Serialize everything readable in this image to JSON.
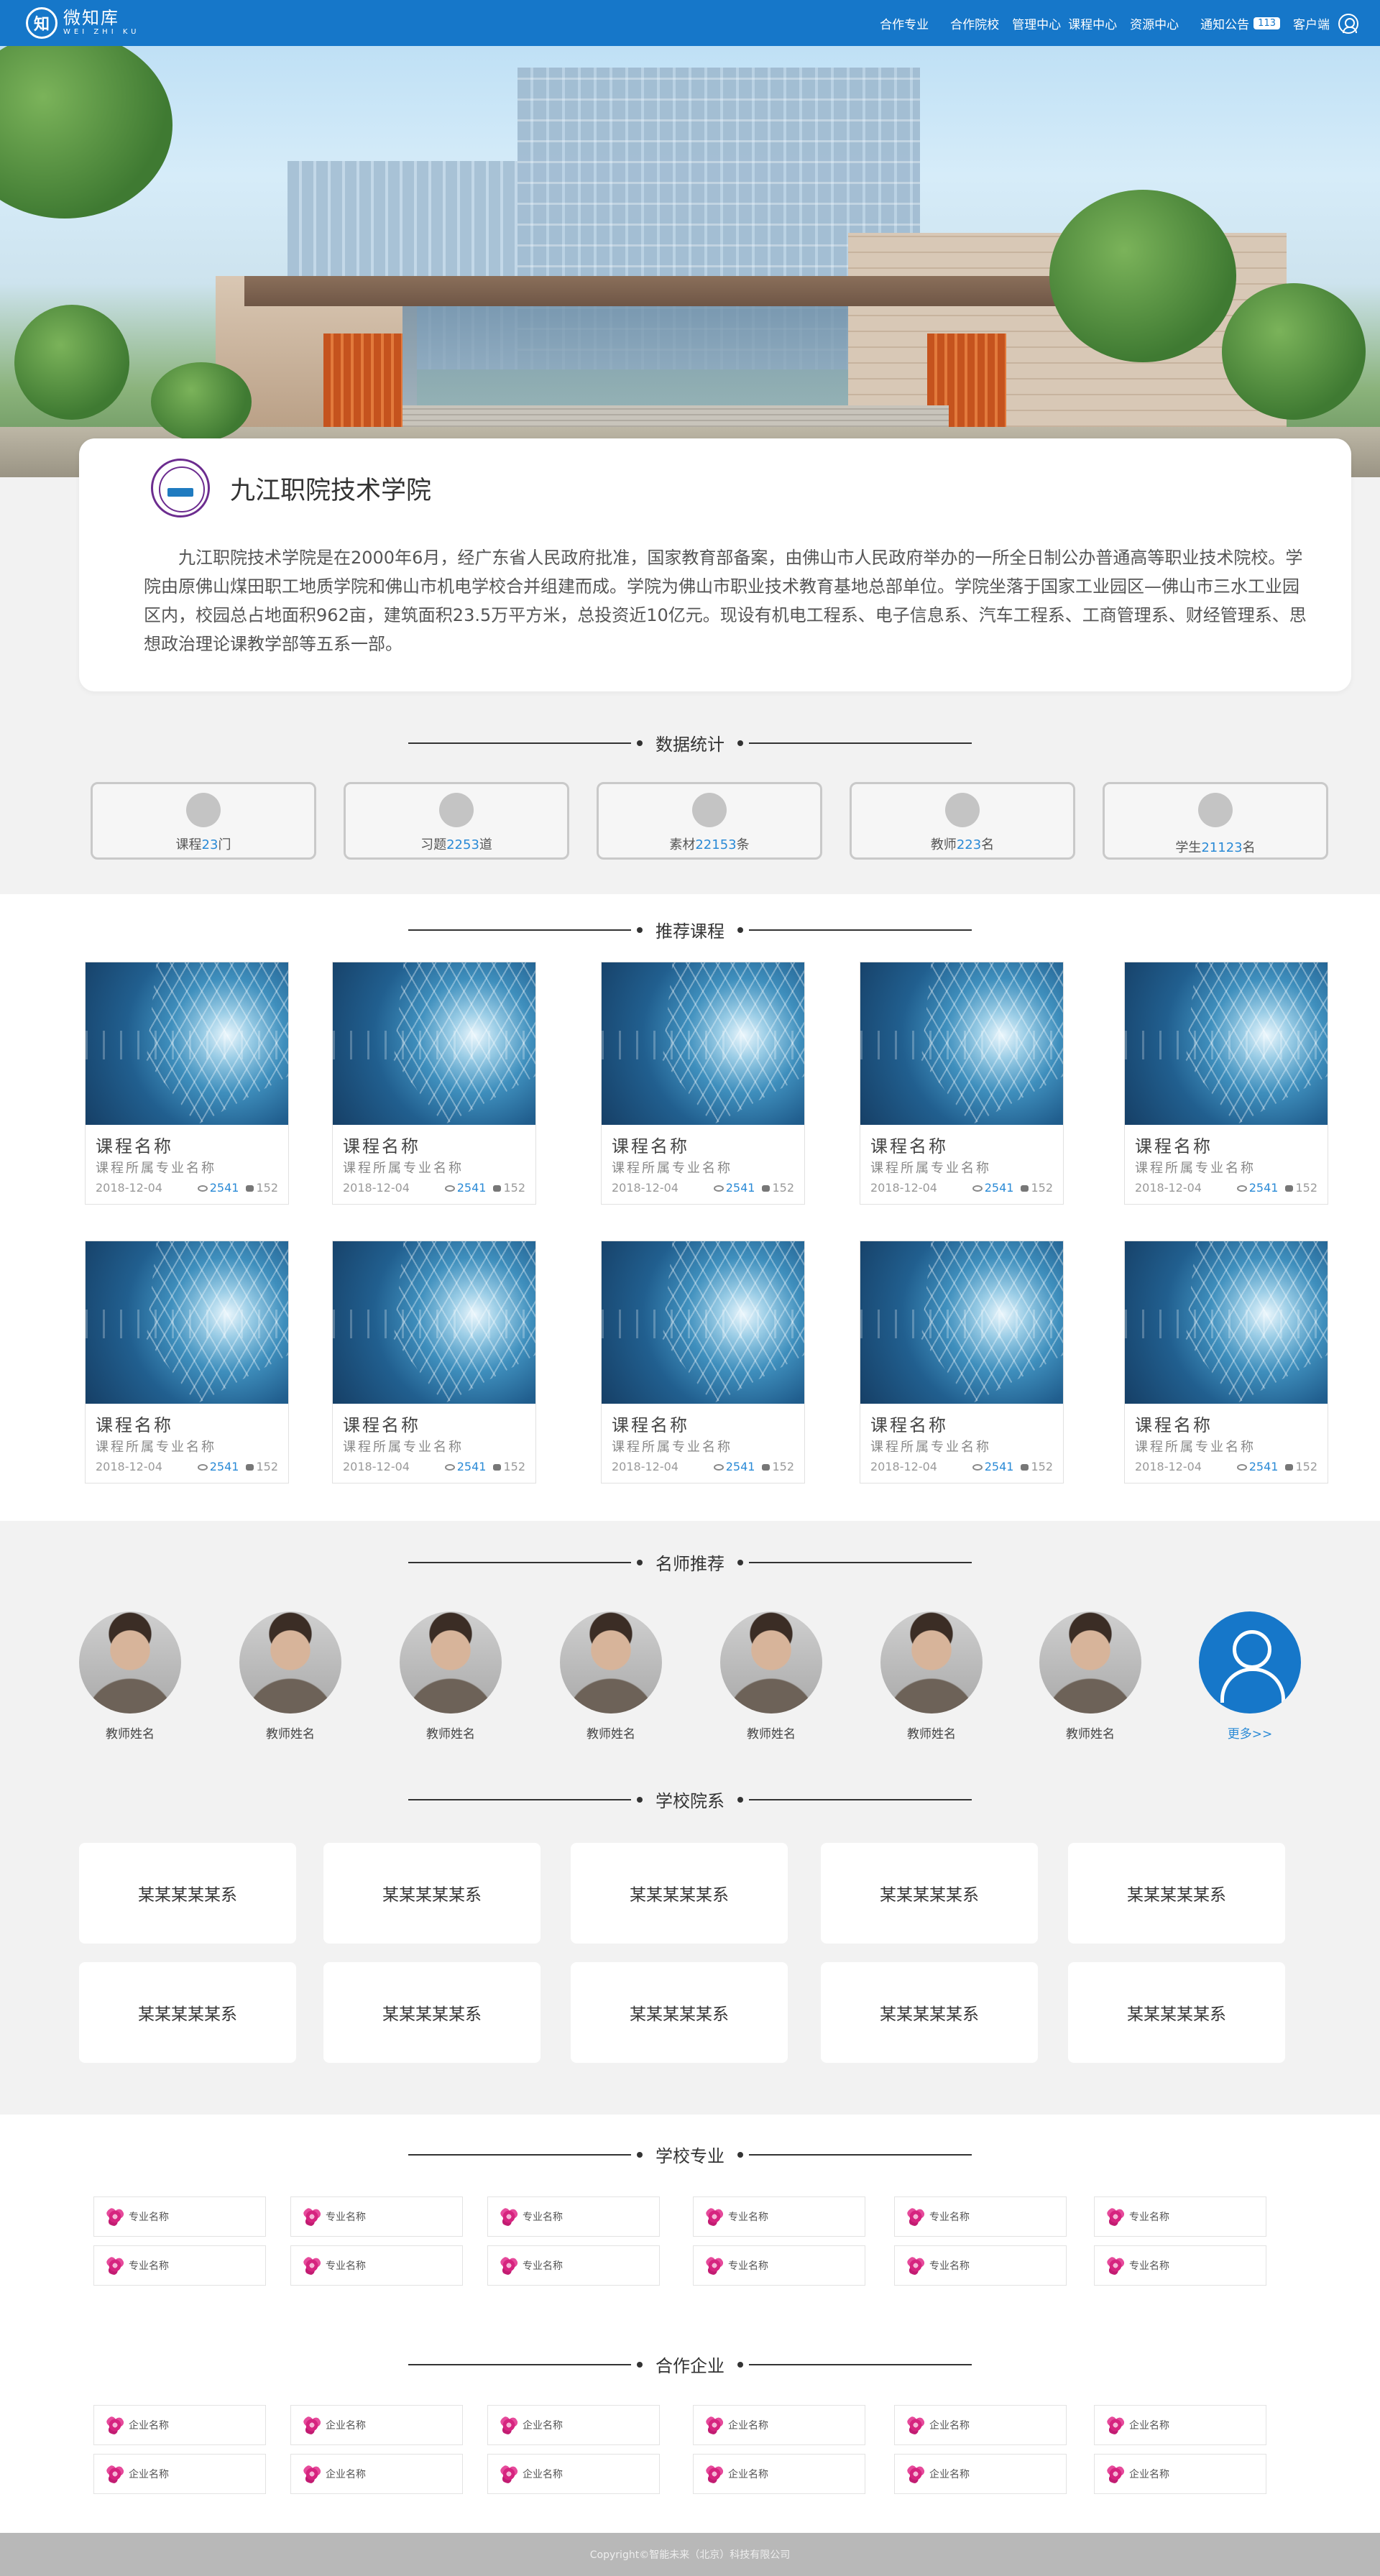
{
  "brand": {
    "logo_glyph": "知",
    "name_cn": "微知库",
    "name_en": "WEI ZHI KU"
  },
  "nav": {
    "items": [
      "合作专业",
      "合作院校",
      "管理中心",
      "课程中心",
      "资源中心"
    ],
    "notice_label": "通知公告",
    "notice_count": "113",
    "client_label": "客户端"
  },
  "school": {
    "name": "九江职院技术学院",
    "description": "九江职院技术学院是在2000年6月，经广东省人民政府批准，国家教育部备案，由佛山市人民政府举办的一所全日制公办普通高等职业技术院校。学院由原佛山煤田职工地质学院和佛山市机电学校合并组建而成。学院为佛山市职业技术教育基地总部单位。学院坐落于国家工业园区—佛山市三水工业园区内，校园总占地面积962亩，建筑面积23.5万平方米，总投资近10亿元。现设有机电工程系、电子信息系、汽车工程系、工商管理系、财经管理系、思想政治理论课教学部等五系一部。"
  },
  "sections": {
    "stats": "数据统计",
    "courses": "推荐课程",
    "teachers": "名师推荐",
    "departments": "学校院系",
    "majors": "学校专业",
    "companies": "合作企业"
  },
  "stats": [
    {
      "label": "课程",
      "value": "23",
      "unit": "门"
    },
    {
      "label": "习题",
      "value": "2253",
      "unit": "道"
    },
    {
      "label": "素材",
      "value": "22153",
      "unit": "条"
    },
    {
      "label": "教师",
      "value": "223",
      "unit": "名"
    },
    {
      "label": "学生",
      "value": "21123",
      "unit": "名"
    }
  ],
  "courses": [
    {
      "name": "课程名称",
      "major": "课程所属专业名称",
      "date": "2018-12-04",
      "views": "2541",
      "comments": "152"
    },
    {
      "name": "课程名称",
      "major": "课程所属专业名称",
      "date": "2018-12-04",
      "views": "2541",
      "comments": "152"
    },
    {
      "name": "课程名称",
      "major": "课程所属专业名称",
      "date": "2018-12-04",
      "views": "2541",
      "comments": "152"
    },
    {
      "name": "课程名称",
      "major": "课程所属专业名称",
      "date": "2018-12-04",
      "views": "2541",
      "comments": "152"
    },
    {
      "name": "课程名称",
      "major": "课程所属专业名称",
      "date": "2018-12-04",
      "views": "2541",
      "comments": "152"
    },
    {
      "name": "课程名称",
      "major": "课程所属专业名称",
      "date": "2018-12-04",
      "views": "2541",
      "comments": "152"
    },
    {
      "name": "课程名称",
      "major": "课程所属专业名称",
      "date": "2018-12-04",
      "views": "2541",
      "comments": "152"
    },
    {
      "name": "课程名称",
      "major": "课程所属专业名称",
      "date": "2018-12-04",
      "views": "2541",
      "comments": "152"
    },
    {
      "name": "课程名称",
      "major": "课程所属专业名称",
      "date": "2018-12-04",
      "views": "2541",
      "comments": "152"
    },
    {
      "name": "课程名称",
      "major": "课程所属专业名称",
      "date": "2018-12-04",
      "views": "2541",
      "comments": "152"
    }
  ],
  "teachers": [
    "教师姓名",
    "教师姓名",
    "教师姓名",
    "教师姓名",
    "教师姓名",
    "教师姓名",
    "教师姓名"
  ],
  "teachers_more": "更多>>",
  "departments": [
    "某某某某某系",
    "某某某某某系",
    "某某某某某系",
    "某某某某某系",
    "某某某某某系",
    "某某某某某系",
    "某某某某某系",
    "某某某某某系",
    "某某某某某系",
    "某某某某某系"
  ],
  "majors": [
    "专业名称",
    "专业名称",
    "专业名称",
    "专业名称",
    "专业名称",
    "专业名称",
    "专业名称",
    "专业名称",
    "专业名称",
    "专业名称",
    "专业名称",
    "专业名称"
  ],
  "companies": [
    "企业名称",
    "企业名称",
    "企业名称",
    "企业名称",
    "企业名称",
    "企业名称",
    "企业名称",
    "企业名称",
    "企业名称",
    "企业名称",
    "企业名称",
    "企业名称"
  ],
  "footer": "Copyright©智能未来（北京）科技有限公司",
  "colors": {
    "primary": "#1677c9",
    "accent_text": "#2a8ad6",
    "flower": "#d6247f"
  }
}
